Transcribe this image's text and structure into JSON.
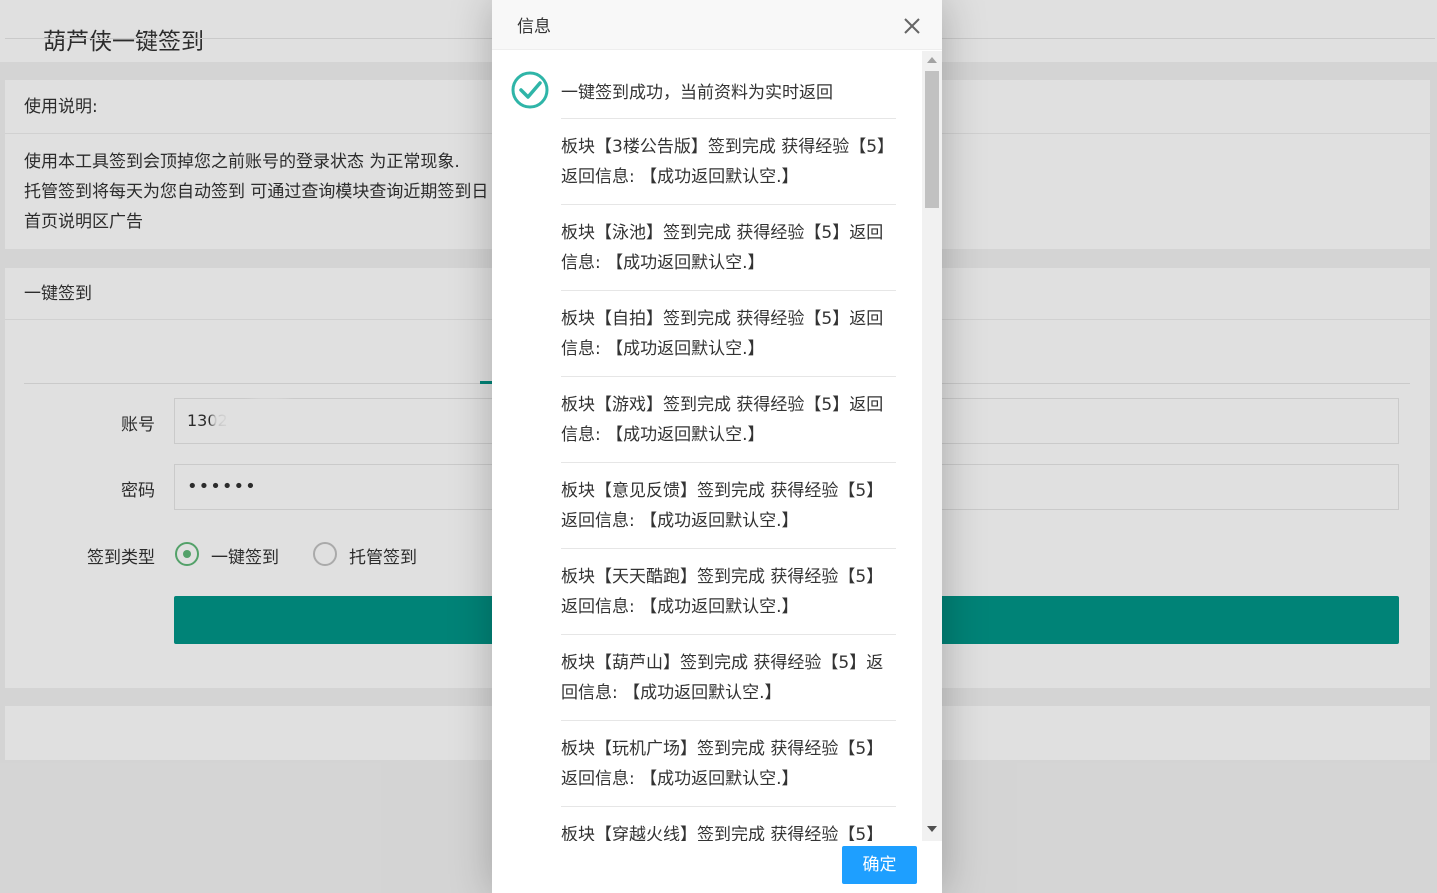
{
  "page": {
    "title": "葫芦侠一键签到",
    "usage": {
      "heading": "使用说明:",
      "lines": [
        "使用本工具签到会顶掉您之前账号的登录状态 为正常现象.",
        "托管签到将每天为您自动签到 可通过查询模块查询近期签到日",
        "首页说明区广告"
      ]
    },
    "sign": {
      "heading": "一键签到",
      "account_label": "账号",
      "account_value": "1302",
      "password_label": "密码",
      "password_value": "••••••",
      "type_label": "签到类型",
      "type_options": [
        "一键签到",
        "托管签到"
      ],
      "type_selected": "一键签到"
    }
  },
  "dialog": {
    "title": "信息",
    "success_message": "一键签到成功，当前资料为实时返回",
    "results": [
      "板块【3楼公告版】签到完成 获得经验【5】返回信息: 【成功返回默认空.】",
      "板块【泳池】签到完成 获得经验【5】返回信息: 【成功返回默认空.】",
      "板块【自拍】签到完成 获得经验【5】返回信息: 【成功返回默认空.】",
      "板块【游戏】签到完成 获得经验【5】返回信息: 【成功返回默认空.】",
      "板块【意见反馈】签到完成 获得经验【5】返回信息: 【成功返回默认空.】",
      "板块【天天酷跑】签到完成 获得经验【5】返回信息: 【成功返回默认空.】",
      "板块【葫芦山】签到完成 获得经验【5】返回信息: 【成功返回默认空.】",
      "板块【玩机广场】签到完成 获得经验【5】返回信息: 【成功返回默认空.】",
      "板块【穿越火线】签到完成 获得经验【5】"
    ],
    "confirm_label": "确定"
  },
  "colors": {
    "primary": "#009688",
    "radio_checked": "#5fb878",
    "confirm": "#1e9fff",
    "success_icon": "#2fb5a8"
  },
  "icons": [
    "close-icon",
    "success-check-icon",
    "scroll-up-arrow-icon",
    "scroll-down-arrow-icon"
  ]
}
